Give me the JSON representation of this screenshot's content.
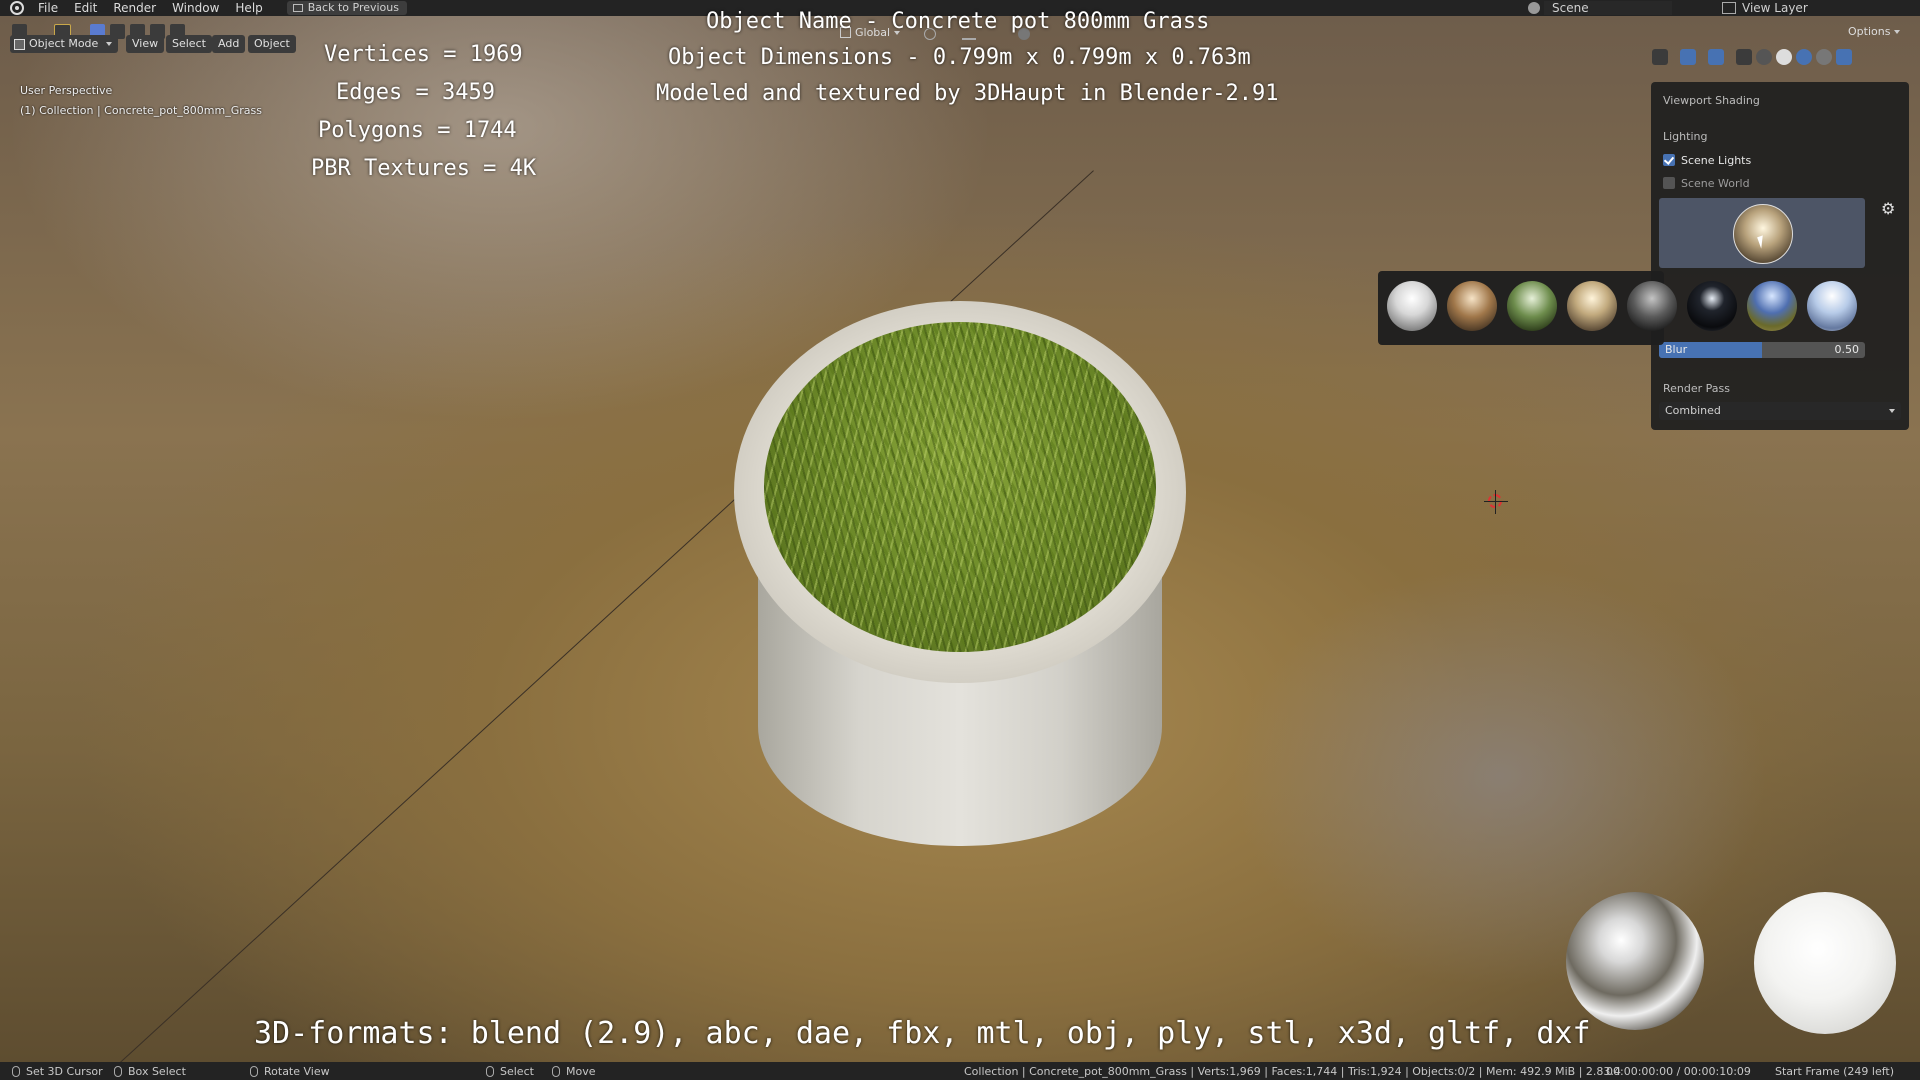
{
  "topbar": {
    "menu": [
      "File",
      "Edit",
      "Render",
      "Window",
      "Help"
    ],
    "back_button": "Back to Previous",
    "scene": "Scene",
    "view_layer": "View Layer"
  },
  "header": {
    "mode": "Object Mode",
    "menus": [
      "View",
      "Select",
      "Add",
      "Object"
    ],
    "transform_orientation": "Global",
    "options": "Options"
  },
  "viewport": {
    "perspective": "User Perspective",
    "collection": "(1) Collection | Concrete_pot_800mm_Grass"
  },
  "overlay_text": {
    "vertices": "Vertices = 1969",
    "edges": "Edges = 3459",
    "polygons": "Polygons = 1744",
    "textures": "PBR Textures = 4K",
    "object_name": "Object Name - Concrete pot 800mm Grass",
    "dimensions": "Object Dimensions -  0.799m x 0.799m x 0.763m",
    "credit": "Modeled and textured by 3DHaupt in Blender-2.91",
    "formats": "3D-formats: blend (2.9), abc, dae, fbx, mtl, obj, ply, stl, x3d, gltf, dxf"
  },
  "shading_panel": {
    "title": "Viewport Shading",
    "lighting": "Lighting",
    "scene_lights": {
      "label": "Scene Lights",
      "checked": true
    },
    "scene_world": {
      "label": "Scene World",
      "checked": false
    },
    "blur": {
      "label": "Blur",
      "value": "0.50",
      "fraction": 0.5
    },
    "render_pass_label": "Render Pass",
    "render_pass_value": "Combined"
  },
  "hdri_thumbnails": [
    "hdri-1-icon",
    "hdri-2-icon",
    "hdri-3-icon",
    "hdri-4-icon",
    "hdri-5-icon",
    "hdri-6-icon",
    "hdri-7-icon",
    "hdri-8-icon"
  ],
  "statusbar": {
    "set_cursor": "Set 3D Cursor",
    "box_select": "Box Select",
    "rotate_view": "Rotate View",
    "select": "Select",
    "move": "Move",
    "stats": "Collection | Concrete_pot_800mm_Grass | Verts:1,969 | Faces:1,744 | Tris:1,924 | Objects:0/2 | Mem: 492.9 MiB | 2.83.4",
    "time": "00:00:00:00 / 00:00:10:09",
    "start_frame": "Start Frame (249 left)"
  },
  "colors": {
    "accent": "#4772b3",
    "panel_bg": "#202020"
  }
}
